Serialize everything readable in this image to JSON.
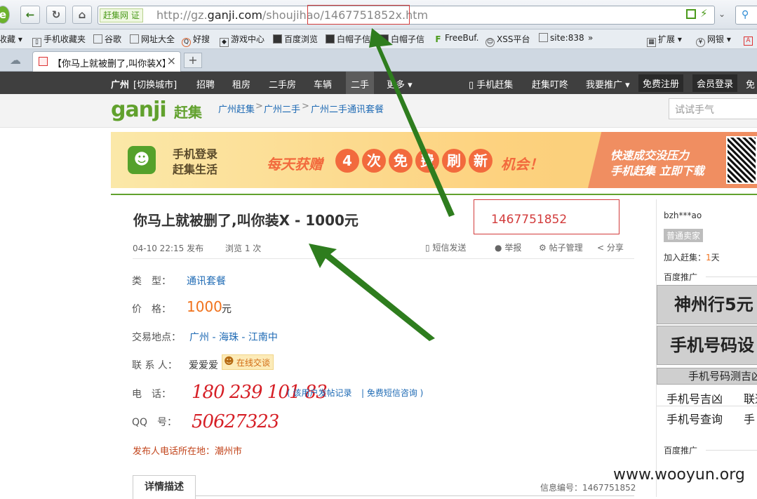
{
  "browser": {
    "badge": "赶集网 证",
    "url_host_prefix": "http://gz.",
    "url_host_main": "ganji.com",
    "url_path": "/shoujihao/",
    "url_file": "1467751852x.htm",
    "bookmarks": [
      "收藏",
      "手机收藏夹",
      "谷歌",
      "网址大全",
      "好搜",
      "游戏中心",
      "百度浏览",
      "白帽子信",
      "白帽子信",
      "FreeBuf.",
      "XSS平台",
      "site:838",
      "»",
      "扩展",
      "网银"
    ],
    "tab_title": "【你马上就被删了,叫你装X】·"
  },
  "site_nav": {
    "city": "广州",
    "switch_city": "[切换城市]",
    "items": [
      "招聘",
      "租房",
      "二手房",
      "车辆",
      "二手",
      "更多"
    ],
    "right": [
      "手机赶集",
      "赶集叮咚",
      "我要推广",
      "免费注册",
      "会员登录",
      "免"
    ]
  },
  "header": {
    "logo": "ganji",
    "logo_cn": "赶集",
    "breadcrumb": [
      "广州赶集",
      "广州二手",
      "广州二手通讯套餐"
    ],
    "search_placeholder": "试试手气"
  },
  "banner": {
    "left_line1": "手机登录",
    "left_line2": "赶集生活",
    "mid_prefix": "每天获赠",
    "circles": [
      "4",
      "次",
      "免",
      "费",
      "刷",
      "新"
    ],
    "mid_suffix": "机会！",
    "right_line1": "快速成交没压力",
    "right_line2": "手机赶集 立即下载"
  },
  "post": {
    "title": "你马上就被删了,叫你装X - 1000元",
    "date": "04-10 22:15 发布",
    "views": "浏览 1 次",
    "actions": [
      "短信发送",
      "举报",
      "帖子管理",
      "分享"
    ],
    "type_label": "类　型：",
    "type_value": "通讯套餐",
    "price_label": "价　格：",
    "price_value": "1000",
    "price_unit": "元",
    "location_label": "交易地点：",
    "location_value": "广州 - 海珠 - 江南中",
    "contact_label": "联 系 人：",
    "contact_name": "爱爱爱",
    "chat_label": "在线交谈",
    "phone_label": "电　话：",
    "phone_value": "180 239 101 83",
    "phone_link1": "( 该用户发帖记录",
    "phone_link2": "| 免费短信咨询 )",
    "qq_label": "QQ　号：",
    "qq_value": "50627323",
    "phone_location": "发布人电话所在地：潮州市",
    "detail_tab": "详情描述",
    "info_id": "信息编号：1467751852"
  },
  "highlight_id": "1467751852",
  "sidebar": {
    "username": "bzh***ao",
    "seller_type": "普通卖家",
    "join_prefix": "加入赶集：",
    "join_days": "1",
    "join_suffix": "天",
    "promo_label": "百度推广",
    "ad1": "神州行5元",
    "ad2": "手机号码设",
    "ad3": "手机号码测吉凶",
    "links": [
      "手机号吉凶",
      "联通",
      "手机号查询",
      "手"
    ],
    "promo_label2": "百度推广"
  },
  "watermark": "www.wooyun.org"
}
